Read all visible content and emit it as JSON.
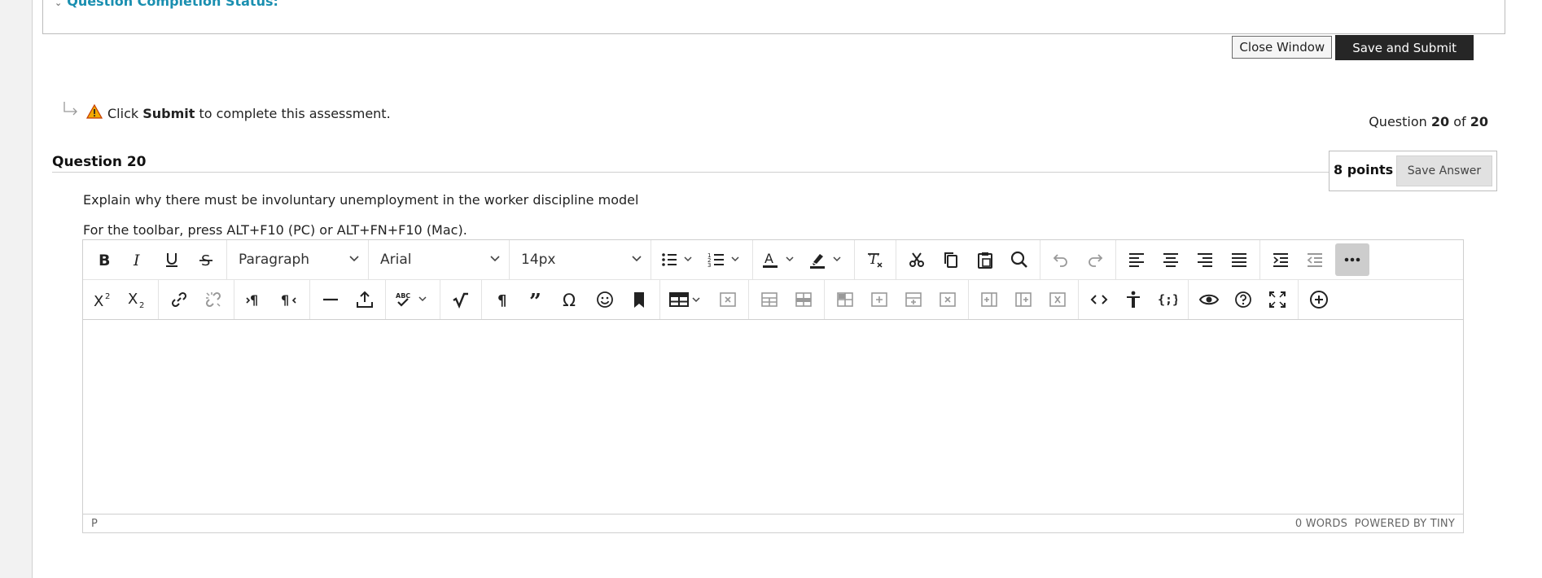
{
  "status_panel": {
    "title": "Question Completion Status:"
  },
  "buttons": {
    "close_window": "Close Window",
    "save_and_submit": "Save and Submit",
    "save_answer": "Save Answer"
  },
  "hint": {
    "prefix": "Click",
    "bold": "Submit",
    "suffix": "to complete this assessment."
  },
  "counter": {
    "prefix": "Question",
    "current": "20",
    "of": "of",
    "total": "20"
  },
  "question": {
    "title": "Question 20",
    "points": "8 points",
    "text": "Explain why there must be involuntary unemployment in the worker discipline model",
    "toolbar_note": "For the toolbar, press ALT+F10 (PC) or ALT+FN+F10 (Mac)."
  },
  "editor": {
    "block_format": "Paragraph",
    "font_family": "Arial",
    "font_size": "14px",
    "status_path": "P",
    "word_count": "0 WORDS",
    "powered_by": "POWERED BY TINY"
  },
  "colors": {
    "submit_bg": "#262626",
    "accent": "#1a8fb0",
    "warning": "#f2a900"
  }
}
